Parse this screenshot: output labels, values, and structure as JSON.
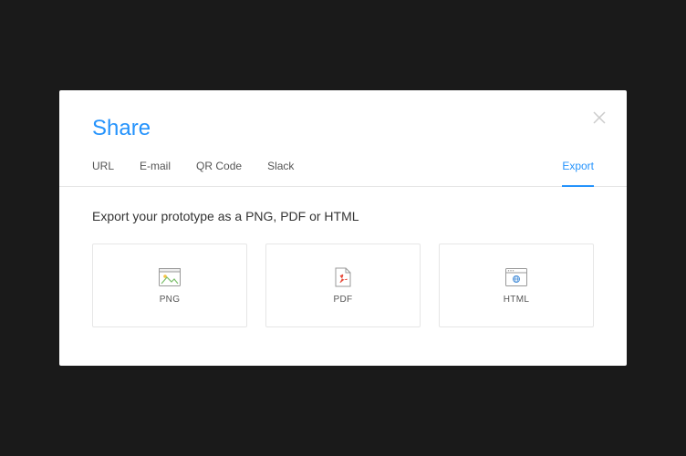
{
  "title": "Share",
  "tabs": {
    "url": "URL",
    "email": "E-mail",
    "qrcode": "QR Code",
    "slack": "Slack",
    "export": "Export"
  },
  "description": "Export your prototype as a PNG, PDF or HTML",
  "cards": {
    "png": "PNG",
    "pdf": "PDF",
    "html": "HTML"
  }
}
